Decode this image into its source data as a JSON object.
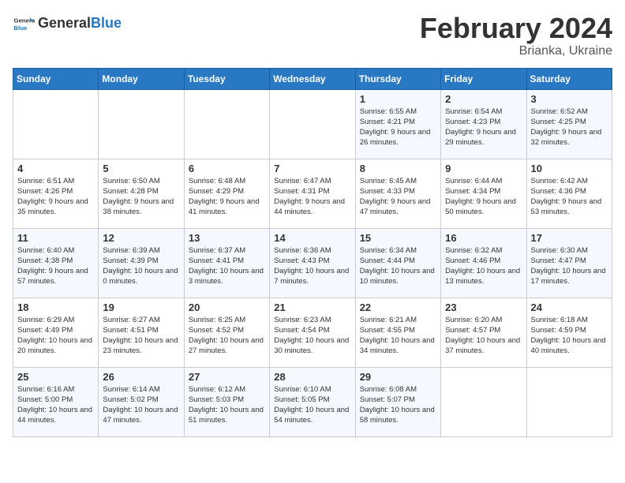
{
  "header": {
    "logo": {
      "general": "General",
      "blue": "Blue"
    },
    "title": "February 2024",
    "subtitle": "Brianka, Ukraine"
  },
  "days_of_week": [
    "Sunday",
    "Monday",
    "Tuesday",
    "Wednesday",
    "Thursday",
    "Friday",
    "Saturday"
  ],
  "weeks": [
    [
      {
        "day": "",
        "info": ""
      },
      {
        "day": "",
        "info": ""
      },
      {
        "day": "",
        "info": ""
      },
      {
        "day": "",
        "info": ""
      },
      {
        "day": "1",
        "info": "Sunrise: 6:55 AM\nSunset: 4:21 PM\nDaylight: 9 hours and 26 minutes."
      },
      {
        "day": "2",
        "info": "Sunrise: 6:54 AM\nSunset: 4:23 PM\nDaylight: 9 hours and 29 minutes."
      },
      {
        "day": "3",
        "info": "Sunrise: 6:52 AM\nSunset: 4:25 PM\nDaylight: 9 hours and 32 minutes."
      }
    ],
    [
      {
        "day": "4",
        "info": "Sunrise: 6:51 AM\nSunset: 4:26 PM\nDaylight: 9 hours and 35 minutes."
      },
      {
        "day": "5",
        "info": "Sunrise: 6:50 AM\nSunset: 4:28 PM\nDaylight: 9 hours and 38 minutes."
      },
      {
        "day": "6",
        "info": "Sunrise: 6:48 AM\nSunset: 4:29 PM\nDaylight: 9 hours and 41 minutes."
      },
      {
        "day": "7",
        "info": "Sunrise: 6:47 AM\nSunset: 4:31 PM\nDaylight: 9 hours and 44 minutes."
      },
      {
        "day": "8",
        "info": "Sunrise: 6:45 AM\nSunset: 4:33 PM\nDaylight: 9 hours and 47 minutes."
      },
      {
        "day": "9",
        "info": "Sunrise: 6:44 AM\nSunset: 4:34 PM\nDaylight: 9 hours and 50 minutes."
      },
      {
        "day": "10",
        "info": "Sunrise: 6:42 AM\nSunset: 4:36 PM\nDaylight: 9 hours and 53 minutes."
      }
    ],
    [
      {
        "day": "11",
        "info": "Sunrise: 6:40 AM\nSunset: 4:38 PM\nDaylight: 9 hours and 57 minutes."
      },
      {
        "day": "12",
        "info": "Sunrise: 6:39 AM\nSunset: 4:39 PM\nDaylight: 10 hours and 0 minutes."
      },
      {
        "day": "13",
        "info": "Sunrise: 6:37 AM\nSunset: 4:41 PM\nDaylight: 10 hours and 3 minutes."
      },
      {
        "day": "14",
        "info": "Sunrise: 6:36 AM\nSunset: 4:43 PM\nDaylight: 10 hours and 7 minutes."
      },
      {
        "day": "15",
        "info": "Sunrise: 6:34 AM\nSunset: 4:44 PM\nDaylight: 10 hours and 10 minutes."
      },
      {
        "day": "16",
        "info": "Sunrise: 6:32 AM\nSunset: 4:46 PM\nDaylight: 10 hours and 13 minutes."
      },
      {
        "day": "17",
        "info": "Sunrise: 6:30 AM\nSunset: 4:47 PM\nDaylight: 10 hours and 17 minutes."
      }
    ],
    [
      {
        "day": "18",
        "info": "Sunrise: 6:29 AM\nSunset: 4:49 PM\nDaylight: 10 hours and 20 minutes."
      },
      {
        "day": "19",
        "info": "Sunrise: 6:27 AM\nSunset: 4:51 PM\nDaylight: 10 hours and 23 minutes."
      },
      {
        "day": "20",
        "info": "Sunrise: 6:25 AM\nSunset: 4:52 PM\nDaylight: 10 hours and 27 minutes."
      },
      {
        "day": "21",
        "info": "Sunrise: 6:23 AM\nSunset: 4:54 PM\nDaylight: 10 hours and 30 minutes."
      },
      {
        "day": "22",
        "info": "Sunrise: 6:21 AM\nSunset: 4:55 PM\nDaylight: 10 hours and 34 minutes."
      },
      {
        "day": "23",
        "info": "Sunrise: 6:20 AM\nSunset: 4:57 PM\nDaylight: 10 hours and 37 minutes."
      },
      {
        "day": "24",
        "info": "Sunrise: 6:18 AM\nSunset: 4:59 PM\nDaylight: 10 hours and 40 minutes."
      }
    ],
    [
      {
        "day": "25",
        "info": "Sunrise: 6:16 AM\nSunset: 5:00 PM\nDaylight: 10 hours and 44 minutes."
      },
      {
        "day": "26",
        "info": "Sunrise: 6:14 AM\nSunset: 5:02 PM\nDaylight: 10 hours and 47 minutes."
      },
      {
        "day": "27",
        "info": "Sunrise: 6:12 AM\nSunset: 5:03 PM\nDaylight: 10 hours and 51 minutes."
      },
      {
        "day": "28",
        "info": "Sunrise: 6:10 AM\nSunset: 5:05 PM\nDaylight: 10 hours and 54 minutes."
      },
      {
        "day": "29",
        "info": "Sunrise: 6:08 AM\nSunset: 5:07 PM\nDaylight: 10 hours and 58 minutes."
      },
      {
        "day": "",
        "info": ""
      },
      {
        "day": "",
        "info": ""
      }
    ]
  ]
}
